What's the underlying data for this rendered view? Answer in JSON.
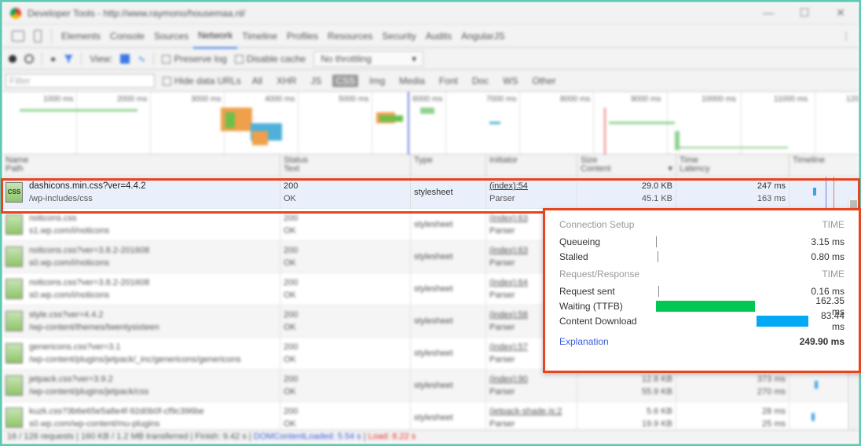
{
  "highlighted_request": {
    "icon_label": "CSS",
    "name": "dashicons.min.css?ver=4.4.2",
    "path": "/wp-includes/css",
    "status_code": "200",
    "status_text": "OK",
    "type": "stylesheet",
    "initiator": "(index):54",
    "initiator_kind": "Parser",
    "size": "29.0 KB",
    "content": "45.1 KB",
    "time": "247 ms",
    "latency": "163 ms"
  },
  "timing_popover": {
    "connection_setup_header": "Connection Setup",
    "time_header": "TIME",
    "queueing_label": "Queueing",
    "queueing_value": "3.15 ms",
    "stalled_label": "Stalled",
    "stalled_value": "0.80 ms",
    "request_response_header": "Request/Response",
    "time_header_2": "TIME",
    "request_sent_label": "Request sent",
    "request_sent_value": "0.16 ms",
    "waiting_label": "Waiting (TTFB)",
    "waiting_value": "162.35 ms",
    "download_label": "Content Download",
    "download_value": "83.44 ms",
    "explanation_link": "Explanation",
    "total_value": "249.90 ms",
    "colors": {
      "ttfb": "#00c853",
      "download": "#03a9f4"
    }
  },
  "background": {
    "window_title": "Developer Tools - http://www.raymono/housemaa.nl/",
    "tabs": [
      "Elements",
      "Console",
      "Sources",
      "Network",
      "Timeline",
      "Profiles",
      "Resources",
      "Security",
      "Audits",
      "AngularJS"
    ],
    "active_tab": "Network",
    "toolbar": {
      "view_label": "View:",
      "preserve_log": "Preserve log",
      "disable_cache": "Disable cache",
      "throttling": "No throttling"
    },
    "filter": {
      "placeholder": "Filter",
      "hide_data_urls": "Hide data URLs",
      "types": [
        "All",
        "XHR",
        "JS",
        "CSS",
        "Img",
        "Media",
        "Font",
        "Doc",
        "WS",
        "Other"
      ],
      "active_type": "CSS"
    },
    "overview_ticks": [
      "1000 ms",
      "2000 ms",
      "3000 ms",
      "4000 ms",
      "5000 ms",
      "6000 ms",
      "7000 ms",
      "8000 ms",
      "9000 ms",
      "10000 ms",
      "11000 ms",
      "120"
    ],
    "columns": [
      {
        "top": "Name",
        "sub": "Path"
      },
      {
        "top": "Status",
        "sub": "Text"
      },
      {
        "top": "Type",
        "sub": ""
      },
      {
        "top": "Initiator",
        "sub": ""
      },
      {
        "top": "Size",
        "sub": "Content"
      },
      {
        "top": "Time",
        "sub": "Latency"
      },
      {
        "top": "Timeline",
        "sub": ""
      }
    ],
    "rows": [
      {
        "name": "noticons.css",
        "path": "s1.wp.com/i/noticons",
        "status": "200",
        "status_text": "OK",
        "type": "stylesheet",
        "initiator": "(index):63",
        "kind": "Parser",
        "size": "",
        "content": "",
        "time": "",
        "latency": ""
      },
      {
        "name": "noticons.css?ver=3.8.2-201608",
        "path": "s0.wp.com/i/noticons",
        "status": "200",
        "status_text": "OK",
        "type": "stylesheet",
        "initiator": "(index):63",
        "kind": "Parser",
        "size": "",
        "content": "",
        "time": "",
        "latency": ""
      },
      {
        "name": "noticons.css?ver=3.8.2-201608",
        "path": "s0.wp.com/i/noticons",
        "status": "200",
        "status_text": "OK",
        "type": "stylesheet",
        "initiator": "(index):64",
        "kind": "Parser",
        "size": "",
        "content": "",
        "time": "",
        "latency": ""
      },
      {
        "name": "style.css?ver=4.4.2",
        "path": "/wp-content/themes/twentysixteen",
        "status": "200",
        "status_text": "OK",
        "type": "stylesheet",
        "initiator": "(index):58",
        "kind": "Parser",
        "size": "",
        "content": "",
        "time": "",
        "latency": ""
      },
      {
        "name": "genericons.css?ver=3.1",
        "path": "/wp-content/plugins/jetpack/_inc/genericons/genericons",
        "status": "200",
        "status_text": "OK",
        "type": "stylesheet",
        "initiator": "(index):57",
        "kind": "Parser",
        "size": "",
        "content": "",
        "time": "",
        "latency": ""
      },
      {
        "name": "jetpack.css?ver=3.9.2",
        "path": "/wp-content/plugins/jetpack/css",
        "status": "200",
        "status_text": "OK",
        "type": "stylesheet",
        "initiator": "(index):90",
        "kind": "Parser",
        "size": "12.8 KB",
        "content": "55.9 KB",
        "time": "373 ms",
        "latency": "270 ms"
      },
      {
        "name": "kuzk.css?3b6e65e5a8e4f-92d0b0f-cf9c396be",
        "path": "s0.wp.com/wp-content/mu-plugins",
        "status": "200",
        "status_text": "OK",
        "type": "stylesheet",
        "initiator": "(jetpack-shade.js:2",
        "kind": "Parser",
        "size": "5.6 KB",
        "content": "19.9 KB",
        "time": "28 ms",
        "latency": "25 ms"
      }
    ],
    "status_summary": "16 / 126 requests | 160 KB / 1.2 MB transferred | Finish: 9.42 s",
    "dom_loaded": "DOMContentLoaded: 5.54 s",
    "load": "Load: 8.22 s"
  }
}
